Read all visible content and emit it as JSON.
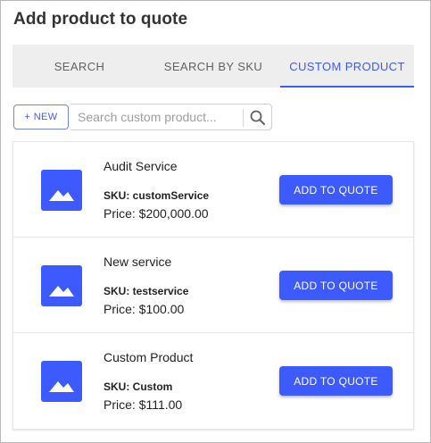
{
  "dialog": {
    "title": "Add product to quote"
  },
  "tabs": [
    {
      "label": "SEARCH",
      "active": false
    },
    {
      "label": "SEARCH BY SKU",
      "active": false
    },
    {
      "label": "CUSTOM PRODUCT",
      "active": true
    }
  ],
  "search": {
    "new_label": "+ NEW",
    "placeholder": "Search custom product...",
    "value": "",
    "search_icon": "magnifier-icon"
  },
  "products": [
    {
      "name": "Audit Service",
      "sku": "SKU: customService",
      "price": "Price: $200,000.00",
      "button": "ADD TO QUOTE",
      "icon": "image-placeholder-icon"
    },
    {
      "name": "New service",
      "sku": "SKU: testservice",
      "price": "Price: $100.00",
      "button": "ADD TO QUOTE",
      "icon": "image-placeholder-icon"
    },
    {
      "name": "Custom Product",
      "sku": "SKU: Custom",
      "price": "Price: $111.00",
      "button": "ADD TO QUOTE",
      "icon": "image-placeholder-icon"
    }
  ],
  "colors": {
    "accent": "#3d5afe",
    "tab_bar_bg": "#eeeeee",
    "text": "#212121"
  }
}
